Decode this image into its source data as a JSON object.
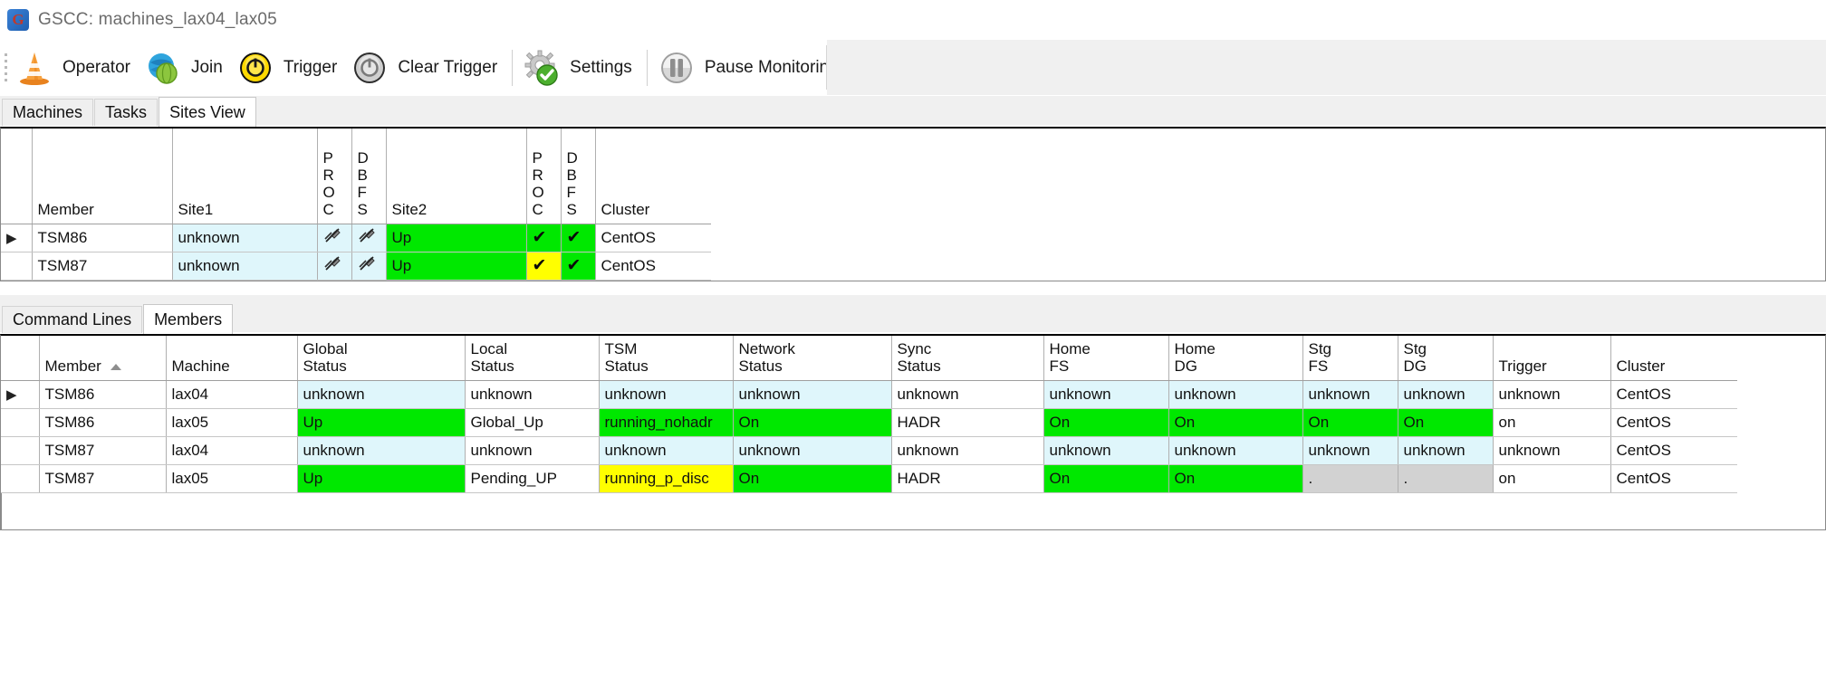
{
  "window": {
    "title": "GSCC: machines_lax04_lax05",
    "icon": "app-logo-icon",
    "icon_letter": "G"
  },
  "toolbar": {
    "items": [
      {
        "label": "Operator",
        "icon": "traffic-cone-icon"
      },
      {
        "label": "Join",
        "icon": "globe-icon"
      },
      {
        "label": "Trigger",
        "icon": "power-button-icon"
      },
      {
        "label": "Clear Trigger",
        "icon": "power-button-gray-icon"
      },
      {
        "label": "Settings",
        "icon": "gear-check-icon"
      },
      {
        "label": "Pause Monitoring",
        "icon": "pause-icon"
      }
    ]
  },
  "top_tabs": {
    "items": [
      {
        "label": "Machines",
        "active": false
      },
      {
        "label": "Tasks",
        "active": false
      },
      {
        "label": "Sites View",
        "active": true
      }
    ]
  },
  "sites_grid": {
    "columns": [
      {
        "label": "",
        "key": "rowhead"
      },
      {
        "label": "Member",
        "key": "member"
      },
      {
        "label": "Site1",
        "key": "site1"
      },
      {
        "label": "PROC",
        "key": "proc1",
        "vertical": true
      },
      {
        "label": "DBFS",
        "key": "dbfs1",
        "vertical": true
      },
      {
        "label": "Site2",
        "key": "site2"
      },
      {
        "label": "PROC",
        "key": "proc2",
        "vertical": true
      },
      {
        "label": "DBFS",
        "key": "dbfs2",
        "vertical": true
      },
      {
        "label": "Cluster",
        "key": "cluster"
      }
    ],
    "rows": [
      {
        "selected": true,
        "member": "TSM86",
        "site1": "unknown",
        "site1_color": "unknown",
        "proc1": "disabled",
        "proc1_color": "unknown",
        "dbfs1": "disabled",
        "dbfs1_color": "unknown",
        "site2": "Up",
        "site2_color": "green",
        "proc2": "check",
        "proc2_color": "green",
        "dbfs2": "check",
        "dbfs2_color": "green",
        "cluster": "CentOS",
        "cluster_color": "white"
      },
      {
        "selected": false,
        "member": "TSM87",
        "site1": "unknown",
        "site1_color": "unknown",
        "proc1": "disabled",
        "proc1_color": "unknown",
        "dbfs1": "disabled",
        "dbfs1_color": "unknown",
        "site2": "Up",
        "site2_color": "green",
        "proc2": "check",
        "proc2_color": "yellow",
        "dbfs2": "check",
        "dbfs2_color": "green",
        "cluster": "CentOS",
        "cluster_color": "white"
      }
    ]
  },
  "bottom_tabs": {
    "items": [
      {
        "label": "Command Lines",
        "active": false
      },
      {
        "label": "Members",
        "active": true
      }
    ]
  },
  "members_grid": {
    "columns": [
      {
        "line1": "",
        "line2": "",
        "key": "rowhead"
      },
      {
        "line1": "Member",
        "line2": "",
        "key": "member",
        "sorted": true,
        "sort_dir": "asc"
      },
      {
        "line1": "Machine",
        "line2": "",
        "key": "machine"
      },
      {
        "line1": "Global",
        "line2": "Status",
        "key": "global_status"
      },
      {
        "line1": "Local",
        "line2": "Status",
        "key": "local_status"
      },
      {
        "line1": "TSM",
        "line2": "Status",
        "key": "tsm_status"
      },
      {
        "line1": "Network",
        "line2": "Status",
        "key": "network_status"
      },
      {
        "line1": "Sync",
        "line2": "Status",
        "key": "sync_status"
      },
      {
        "line1": "Home",
        "line2": "FS",
        "key": "home_fs"
      },
      {
        "line1": "Home",
        "line2": "DG",
        "key": "home_dg"
      },
      {
        "line1": "Stg",
        "line2": "FS",
        "key": "stg_fs"
      },
      {
        "line1": "Stg",
        "line2": "DG",
        "key": "stg_dg"
      },
      {
        "line1": "Trigger",
        "line2": "",
        "key": "trigger"
      },
      {
        "line1": "Cluster",
        "line2": "",
        "key": "cluster"
      }
    ],
    "rows": [
      {
        "selected": true,
        "member": "TSM86",
        "machine": "lax04",
        "global_status": "unknown",
        "global_status_color": "unknown",
        "local_status": "unknown",
        "local_status_color": "white",
        "tsm_status": "unknown",
        "tsm_status_color": "unknown",
        "network_status": "unknown",
        "network_status_color": "unknown",
        "sync_status": "unknown",
        "sync_status_color": "white",
        "home_fs": "unknown",
        "home_fs_color": "unknown",
        "home_dg": "unknown",
        "home_dg_color": "unknown",
        "stg_fs": "unknown",
        "stg_fs_color": "unknown",
        "stg_dg": "unknown",
        "stg_dg_color": "unknown",
        "trigger": "unknown",
        "trigger_color": "white",
        "cluster": "CentOS",
        "cluster_color": "white"
      },
      {
        "selected": false,
        "member": "TSM86",
        "machine": "lax05",
        "global_status": "Up",
        "global_status_color": "green",
        "local_status": "Global_Up",
        "local_status_color": "white",
        "tsm_status": "running_nohadr",
        "tsm_status_color": "green",
        "network_status": "On",
        "network_status_color": "green",
        "sync_status": "HADR",
        "sync_status_color": "white",
        "home_fs": "On",
        "home_fs_color": "green",
        "home_dg": "On",
        "home_dg_color": "green",
        "stg_fs": "On",
        "stg_fs_color": "green",
        "stg_dg": "On",
        "stg_dg_color": "green",
        "trigger": "on",
        "trigger_color": "white",
        "cluster": "CentOS",
        "cluster_color": "white"
      },
      {
        "selected": false,
        "member": "TSM87",
        "machine": "lax04",
        "global_status": "unknown",
        "global_status_color": "unknown",
        "local_status": "unknown",
        "local_status_color": "white",
        "tsm_status": "unknown",
        "tsm_status_color": "unknown",
        "network_status": "unknown",
        "network_status_color": "unknown",
        "sync_status": "unknown",
        "sync_status_color": "white",
        "home_fs": "unknown",
        "home_fs_color": "unknown",
        "home_dg": "unknown",
        "home_dg_color": "unknown",
        "stg_fs": "unknown",
        "stg_fs_color": "unknown",
        "stg_dg": "unknown",
        "stg_dg_color": "unknown",
        "trigger": "unknown",
        "trigger_color": "white",
        "cluster": "CentOS",
        "cluster_color": "white"
      },
      {
        "selected": false,
        "member": "TSM87",
        "machine": "lax05",
        "global_status": "Up",
        "global_status_color": "green",
        "local_status": "Pending_UP",
        "local_status_color": "white",
        "tsm_status": "running_p_disc",
        "tsm_status_color": "yellow",
        "network_status": "On",
        "network_status_color": "green",
        "sync_status": "HADR",
        "sync_status_color": "white",
        "home_fs": "On",
        "home_fs_color": "green",
        "home_dg": "On",
        "home_dg_color": "green",
        "stg_fs": ".",
        "stg_fs_color": "gray",
        "stg_dg": ".",
        "stg_dg_color": "gray",
        "trigger": "on",
        "trigger_color": "white",
        "cluster": "CentOS",
        "cluster_color": "white"
      }
    ]
  },
  "colors": {
    "green": "#00e800",
    "yellow": "#ffff00",
    "unknown_cyan": "#dff6fb",
    "gray": "#d2d2d2"
  }
}
